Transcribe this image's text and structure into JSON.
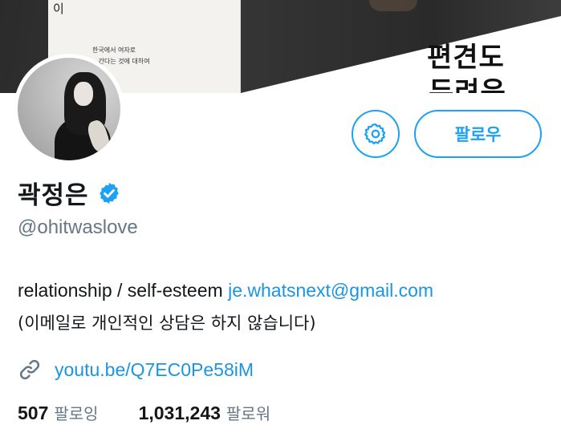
{
  "banner": {
    "book_title_fragment": "이",
    "book_subtitle_line1": "한국에서 여자로",
    "book_subtitle_line2": "...간다는 것에 대하여",
    "headline_line1": "편견도",
    "headline_line2": "두려운"
  },
  "profile": {
    "display_name": "곽정은",
    "handle": "@ohitwaslove",
    "verified": true,
    "bio_line1_text": "relationship / self-esteem ",
    "bio_line1_email": "je.whatsnext@gmail.com",
    "bio_line2": "(이메일로 개인적인 상담은 하지 않습니다)",
    "link": "youtu.be/Q7EC0Pe58iM"
  },
  "actions": {
    "follow_label": "팔로우",
    "settings_icon": "gear-icon"
  },
  "stats": {
    "following_count": "507",
    "following_label": "팔로잉",
    "followers_count": "1,031,243",
    "followers_label": "팔로워"
  },
  "colors": {
    "accent": "#1da1f2",
    "link": "#1b95e0",
    "secondary_text": "#657786",
    "primary_text": "#14171a"
  }
}
